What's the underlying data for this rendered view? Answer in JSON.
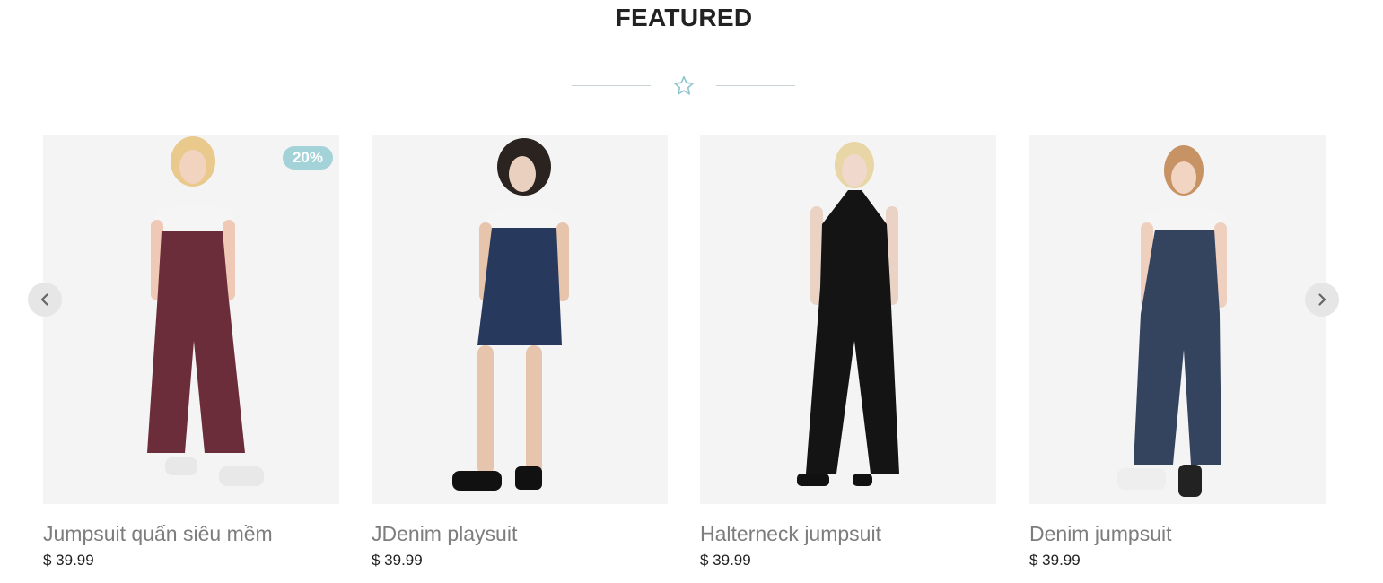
{
  "section": {
    "title": "FEATURED",
    "divider_icon": "star-outline-icon",
    "accent_color": "#a3d3d9"
  },
  "carousel": {
    "prev_icon": "chevron-left-icon",
    "next_icon": "chevron-right-icon",
    "products": [
      {
        "name": "Jumpsuit quấn siêu mềm",
        "price": "$ 39.99",
        "badge": "20%",
        "image": "model-wine-jumpsuit-photo",
        "garment_color": "#6b2d39"
      },
      {
        "name": "JDenim playsuit",
        "price": "$ 39.99",
        "image": "model-denim-playsuit-photo",
        "garment_color": "#27395c"
      },
      {
        "name": "Halterneck jumpsuit",
        "price": "$ 39.99",
        "image": "model-black-halterneck-jumpsuit-photo",
        "garment_color": "#141414"
      },
      {
        "name": "Denim jumpsuit",
        "price": "$ 39.99",
        "image": "model-denim-overall-jumpsuit-photo",
        "garment_color": "#34445e"
      }
    ]
  }
}
